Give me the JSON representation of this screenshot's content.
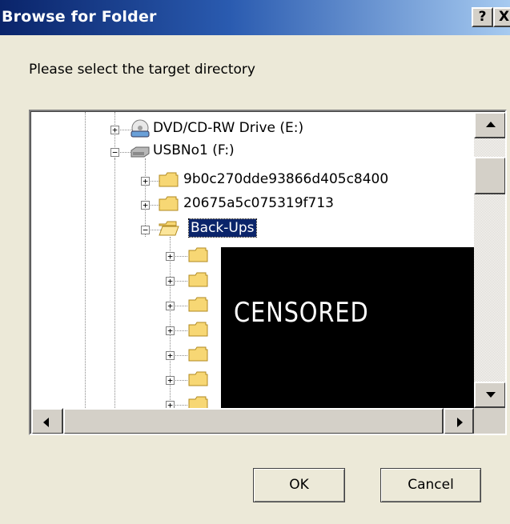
{
  "window": {
    "title": "Browse for Folder",
    "help_label": "?",
    "close_label": "X"
  },
  "prompt": "Please select the target directory",
  "tree": {
    "items": [
      {
        "label": "DVD/CD-RW Drive (E:)",
        "icon": "dvd-drive-icon",
        "expander": "+"
      },
      {
        "label": "USBNo1 (F:)",
        "icon": "removable-drive-icon",
        "expander": "−"
      },
      {
        "label": "9b0c270dde93866d405c8400",
        "icon": "folder-icon",
        "expander": "+"
      },
      {
        "label": "20675a5c075319f713",
        "icon": "folder-icon",
        "expander": "+"
      },
      {
        "label": "Back-Ups",
        "icon": "open-folder-icon",
        "expander": "−",
        "selected": true
      }
    ],
    "censored_label": "CENSORED",
    "hidden_folder_count": 7
  },
  "buttons": {
    "ok": "OK",
    "cancel": "Cancel"
  },
  "colors": {
    "title_start": "#0a246a",
    "title_end": "#a6caf0",
    "selection": "#0a246a",
    "dialog_bg": "#ece9d8"
  }
}
